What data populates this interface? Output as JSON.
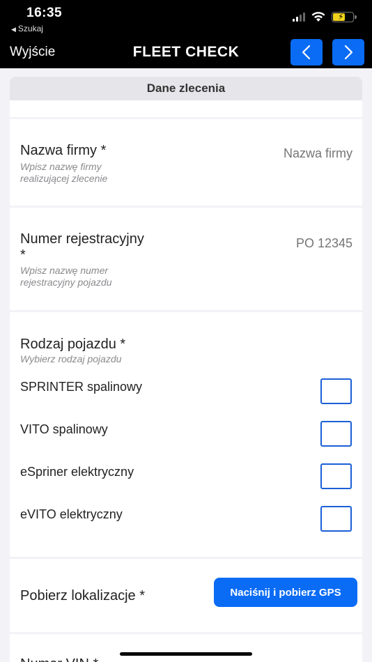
{
  "status": {
    "time": "16:35",
    "back_app": "Szukaj"
  },
  "nav": {
    "exit_label": "Wyjście",
    "title": "FLEET CHECK"
  },
  "section": {
    "title": "Dane zlecenia"
  },
  "fields": {
    "company": {
      "label": "Nazwa firmy *",
      "hint_line1": "Wpisz nazwę firmy",
      "hint_line2": "realizującej zlecenie",
      "placeholder": "Nazwa firmy",
      "value": ""
    },
    "registration": {
      "label_line1": "Numer rejestracyjny",
      "label_line2": "*",
      "hint_line1": "Wpisz nazwę numer",
      "hint_line2": "rejestracyjny pojazdu",
      "placeholder": "PO 12345",
      "value": ""
    },
    "vehicle_type": {
      "label": "Rodzaj pojazdu *",
      "hint": "Wybierz rodzaj pojazdu",
      "options": [
        {
          "label": "SPRINTER spalinowy",
          "checked": false
        },
        {
          "label": "VITO spalinowy",
          "checked": false
        },
        {
          "label": "eSpriner elektryczny",
          "checked": false
        },
        {
          "label": "eVITO elektryczny",
          "checked": false
        }
      ]
    },
    "location": {
      "label": "Pobierz lokalizacje *",
      "button_label": "Naciśnij i pobierz GPS"
    },
    "vin": {
      "label": "Numer VIN *"
    }
  },
  "colors": {
    "accent": "#0a6cf5",
    "checkbox_border": "#1a5fd6"
  }
}
